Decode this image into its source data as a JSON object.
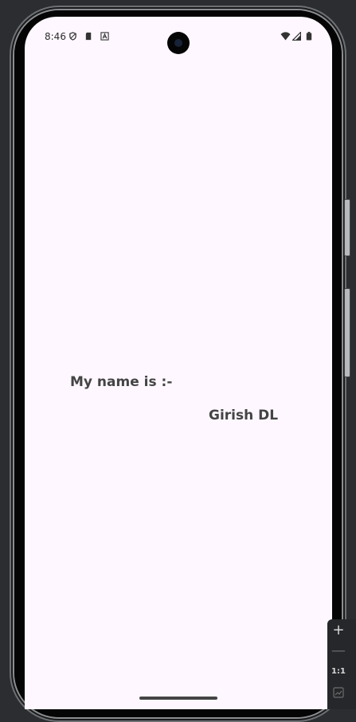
{
  "status_bar": {
    "time": "8:46",
    "left_icons": [
      "shield-icon",
      "sd-card-icon",
      "font-a-icon"
    ],
    "right_icons": [
      "wifi-icon",
      "signal-icon",
      "battery-icon"
    ]
  },
  "main": {
    "label": "My name is :-",
    "value": "Girish DL"
  },
  "emulator_controls": {
    "zoom_in": "+",
    "zoom_out": "—",
    "actual_size": "1:1"
  },
  "colors": {
    "screen_background": "#fef7ff",
    "text": "#444444"
  }
}
